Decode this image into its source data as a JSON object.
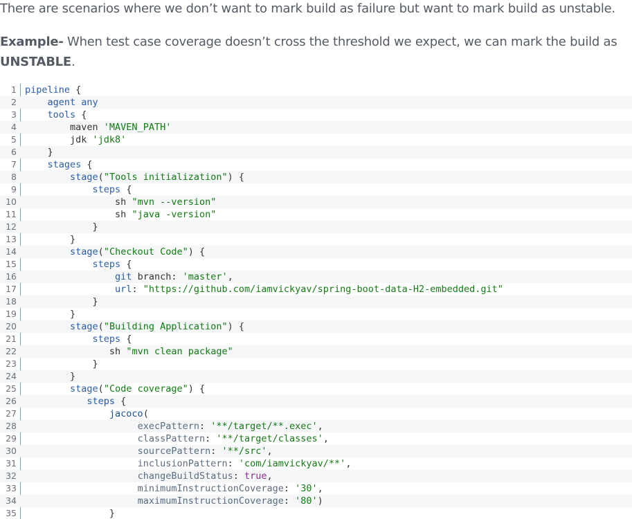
{
  "intro_text": "There are scenarios where we don’t want to mark build as failure but want to mark build as unstable.",
  "example": {
    "label": "Example-",
    "text": " When test case coverage doesn’t cross the threshold we expect, we can mark the build as",
    "emphasis": "UNSTABLE",
    "tail": "."
  },
  "code": {
    "lines": [
      {
        "num": "1",
        "text": "pipeline {"
      },
      {
        "num": "2",
        "text": "    agent any"
      },
      {
        "num": "3",
        "text": "    tools {"
      },
      {
        "num": "4",
        "text": "        maven 'MAVEN_PATH'"
      },
      {
        "num": "5",
        "text": "        jdk 'jdk8'"
      },
      {
        "num": "6",
        "text": "    }"
      },
      {
        "num": "7",
        "text": "    stages {"
      },
      {
        "num": "8",
        "text": "        stage(\"Tools initialization\") {"
      },
      {
        "num": "9",
        "text": "            steps {"
      },
      {
        "num": "10",
        "text": "                sh \"mvn --version\""
      },
      {
        "num": "11",
        "text": "                sh \"java -version\""
      },
      {
        "num": "12",
        "text": "            }"
      },
      {
        "num": "13",
        "text": "        }"
      },
      {
        "num": "14",
        "text": "        stage(\"Checkout Code\") {"
      },
      {
        "num": "15",
        "text": "            steps {"
      },
      {
        "num": "16",
        "text": "                git branch: 'master',"
      },
      {
        "num": "17",
        "text": "                url: \"https://github.com/iamvickyav/spring-boot-data-H2-embedded.git\""
      },
      {
        "num": "18",
        "text": "            }"
      },
      {
        "num": "19",
        "text": "        }"
      },
      {
        "num": "20",
        "text": "        stage(\"Building Application\") {"
      },
      {
        "num": "21",
        "text": "            steps {"
      },
      {
        "num": "22",
        "text": "               sh \"mvn clean package\""
      },
      {
        "num": "23",
        "text": "            }"
      },
      {
        "num": "24",
        "text": "        }"
      },
      {
        "num": "25",
        "text": "        stage(\"Code coverage\") {"
      },
      {
        "num": "26",
        "text": "           steps {"
      },
      {
        "num": "27",
        "text": "               jacoco("
      },
      {
        "num": "28",
        "text": "                    execPattern: '**/target/**.exec',"
      },
      {
        "num": "29",
        "text": "                    classPattern: '**/target/classes',"
      },
      {
        "num": "30",
        "text": "                    sourcePattern: '**/src',"
      },
      {
        "num": "31",
        "text": "                    inclusionPattern: 'com/iamvickyav/**',"
      },
      {
        "num": "32",
        "text": "                    changeBuildStatus: true,"
      },
      {
        "num": "33",
        "text": "                    minimumInstructionCoverage: '30',"
      },
      {
        "num": "34",
        "text": "                    maximumInstructionCoverage: '80')"
      },
      {
        "num": "35",
        "text": "               }"
      }
    ]
  }
}
